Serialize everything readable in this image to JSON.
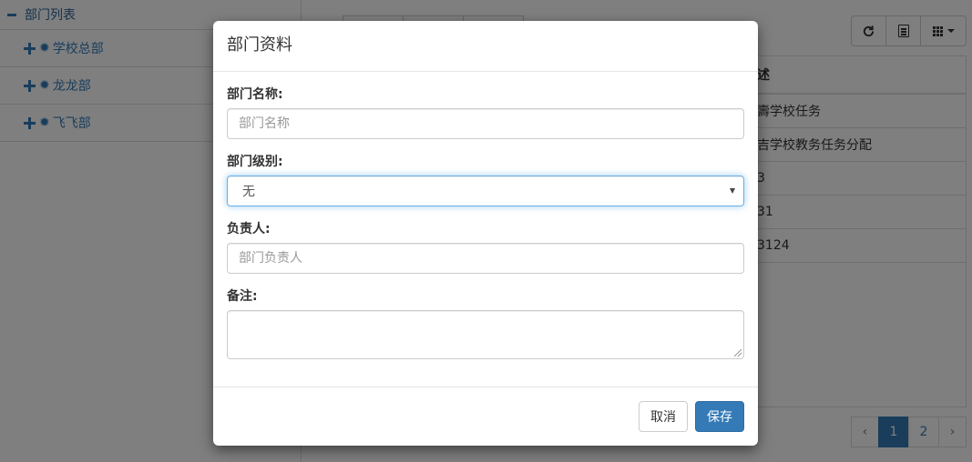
{
  "sidebar": {
    "root_label": "部门列表",
    "items": [
      {
        "label": "学校总部"
      },
      {
        "label": "龙龙部"
      },
      {
        "label": "飞飞部"
      }
    ]
  },
  "table": {
    "header": "述",
    "rows": [
      "壽学校任务",
      "吉学校教务任务分配",
      "3",
      "31",
      "3124"
    ]
  },
  "pagination": {
    "prev": "‹",
    "pages": [
      "1",
      "2"
    ],
    "active_page": "1",
    "next": "›"
  },
  "icons": {
    "refresh": "refresh-icon",
    "list": "list-icon",
    "columns": "grid-icon",
    "tree_expand": "plus-icon",
    "tree_collapse": "minus-icon",
    "tree_node": "gear-icon"
  },
  "modal": {
    "title": "部门资料",
    "fields": {
      "name": {
        "label": "部门名称:",
        "placeholder": "部门名称"
      },
      "level": {
        "label": "部门级别:",
        "selected": "无"
      },
      "manager": {
        "label": "负责人:",
        "placeholder": "部门负责人"
      },
      "remark": {
        "label": "备注:"
      }
    },
    "cancel_label": "取消",
    "save_label": "保存"
  },
  "colors": {
    "primary": "#337ab7",
    "focus_border": "#66afe9",
    "overlay": "rgba(0,0,0,0.5)"
  }
}
